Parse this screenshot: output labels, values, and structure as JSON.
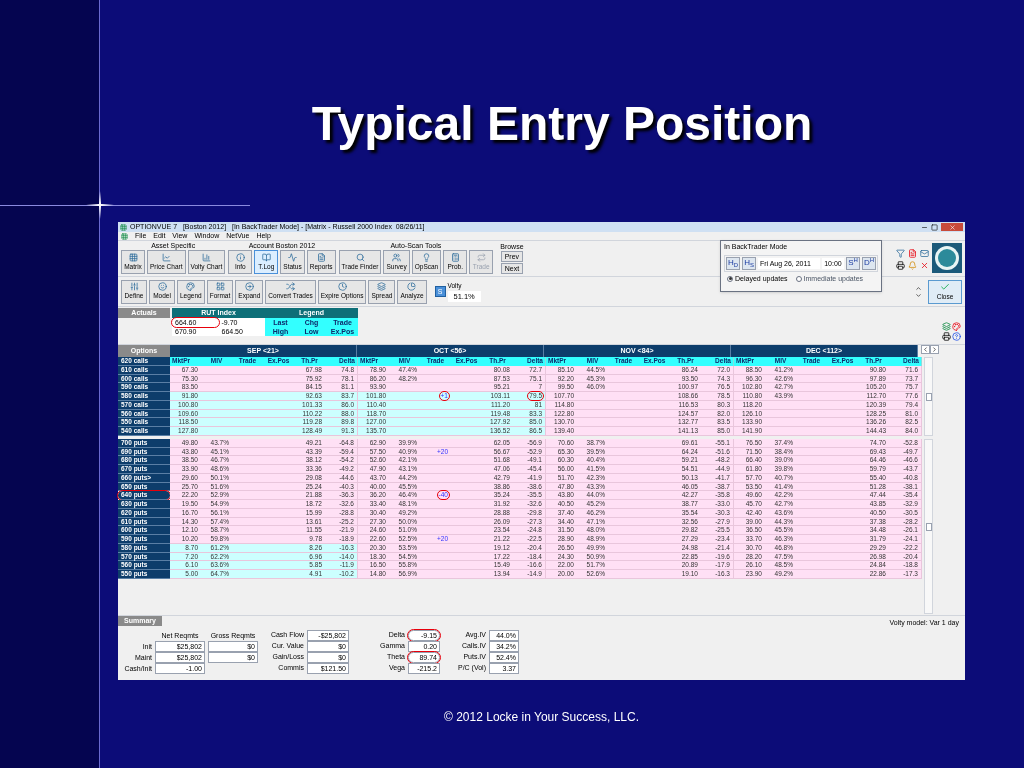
{
  "slide": {
    "title": "Typical Entry Position",
    "footer": "© 2012 Locke in Your Success, LLC."
  },
  "window": {
    "title": "OPTIONVUE 7   [Boston 2012]   [In BackTrader Mode] - [Matrix - Russell 2000 Index  08/26/11]"
  },
  "menu": [
    "File",
    "Edit",
    "View",
    "Window",
    "NetVue",
    "Help"
  ],
  "toolbar_groups": [
    {
      "label": "Asset Specific",
      "buttons": [
        {
          "label": "Matrix",
          "selected": false,
          "disabled": false
        },
        {
          "label": "Price Chart",
          "selected": false,
          "disabled": false
        },
        {
          "label": "Volty Chart",
          "selected": false,
          "disabled": false
        }
      ]
    },
    {
      "label": "Account Boston 2012",
      "buttons": [
        {
          "label": "Info",
          "selected": false,
          "disabled": false
        },
        {
          "label": "T.Log",
          "selected": true,
          "disabled": false
        },
        {
          "label": "Status",
          "selected": false,
          "disabled": false
        },
        {
          "label": "Reports",
          "selected": false,
          "disabled": false
        }
      ]
    },
    {
      "label": "Auto-Scan Tools",
      "buttons": [
        {
          "label": "Trade Finder",
          "selected": false,
          "disabled": false
        },
        {
          "label": "Survey",
          "selected": false,
          "disabled": false
        },
        {
          "label": "OpScan",
          "selected": false,
          "disabled": false
        },
        {
          "label": "Prob.",
          "selected": false,
          "disabled": false
        },
        {
          "label": "Trade",
          "selected": false,
          "disabled": true
        }
      ]
    }
  ],
  "browse": {
    "label": "Browse",
    "buttons": [
      "Prev",
      "Next"
    ]
  },
  "toolbar2": [
    "Define",
    "Model",
    "Legend",
    "Format",
    "Expand",
    "Convert Trades",
    "Expire Options",
    "Spread",
    "Analyze"
  ],
  "volty": {
    "button": "S",
    "label": "Volty",
    "value": "51.1%"
  },
  "backtrader": {
    "title": "In BackTrader Mode",
    "left_buttons": [
      "H$_{D}$",
      "H$_{S}$"
    ],
    "date": "Fri Aug 26, 2011",
    "time": "10:00",
    "right_buttons": [
      "S$^{H}$",
      "D$^{H}$"
    ],
    "options": [
      {
        "label": "Delayed updates",
        "selected": true
      },
      {
        "label": "Immediate updates",
        "selected": false
      }
    ]
  },
  "close_button": "Close",
  "actuals": {
    "label": "Actuals",
    "index_title": "RUT Index",
    "values": [
      {
        "text": "664.60",
        "circled": true
      },
      "-9.70",
      "670.90",
      "664.50"
    ],
    "legend_title": "Legend",
    "legend": [
      "Last",
      "Chg",
      "Trade",
      "High",
      "Low",
      "Ex.Pos"
    ]
  },
  "table": {
    "label": "Options",
    "months": [
      {
        "label": "SEP <21>",
        "columns": [
          "MktPr",
          "MIV",
          "Trade",
          "Ex.Pos",
          "Th.Pr",
          "Delta"
        ]
      },
      {
        "label": "OCT <56>",
        "columns": [
          "MktPr",
          "MIV",
          "Trade",
          "Ex.Pos",
          "Th.Pr",
          "Delta"
        ]
      },
      {
        "label": "NOV <84>",
        "columns": [
          "MktPr",
          "MIV",
          "Trade",
          "Ex.Pos",
          "Th.Pr",
          "Delta"
        ]
      },
      {
        "label": "DEC <112>",
        "columns": [
          "MktPr",
          "MIV",
          "Trade",
          "Ex.Pos",
          "Th.Pr",
          "Delta"
        ]
      }
    ],
    "header_row_label": "620 calls",
    "calls": [
      {
        "label": "610 calls",
        "months": [
          {
            "mkt": "67.30",
            "th": "67.98",
            "delta": "74.8",
            "itm": false
          },
          {
            "mkt": "78.90",
            "miv": "47.4%",
            "th": "80.08",
            "delta": "72.7",
            "itm": false
          },
          {
            "mkt": "85.10",
            "miv": "44.5%",
            "th": "86.24",
            "delta": "72.0",
            "itm": false
          },
          {
            "mkt": "88.50",
            "miv": "41.2%",
            "th": "90.80",
            "delta": "71.6",
            "itm": false
          }
        ]
      },
      {
        "label": "600 calls",
        "months": [
          {
            "mkt": "75.30",
            "th": "75.92",
            "delta": "78.1",
            "itm": false
          },
          {
            "mkt": "86.20",
            "miv": "48.2%",
            "th": "87.53",
            "delta": "75.1",
            "itm": false
          },
          {
            "mkt": "92.20",
            "miv": "45.3%",
            "th": "93.50",
            "delta": "74.3",
            "itm": false
          },
          {
            "mkt": "96.30",
            "miv": "42.6%",
            "th": "97.89",
            "delta": "73.7",
            "itm": false
          }
        ]
      },
      {
        "label": "590 calls",
        "months": [
          {
            "mkt": "83.50",
            "th": "84.15",
            "delta": "81.1",
            "itm": false
          },
          {
            "mkt": "93.90",
            "th": "95.21",
            "delta": "7",
            "itm": false
          },
          {
            "mkt": "99.50",
            "miv": "46.0%",
            "th": "100.97",
            "delta": "76.5",
            "itm": false
          },
          {
            "mkt": "102.80",
            "miv": "42.7%",
            "th": "105.20",
            "delta": "75.7",
            "itm": false
          }
        ]
      },
      {
        "label": "580 calls",
        "months": [
          {
            "mkt": "91.80",
            "th": "92.63",
            "delta": "83.7",
            "itm": true
          },
          {
            "mkt": "101.80",
            "trade": {
              "text": "+1",
              "circled": true
            },
            "th": "103.11",
            "delta": {
              "text": "79.5",
              "circled": true
            },
            "itm": true
          },
          {
            "mkt": "107.70",
            "th": "108.66",
            "delta": "78.5",
            "itm": false
          },
          {
            "mkt": "110.80",
            "miv": "43.9%",
            "th": "112.70",
            "delta": "77.6",
            "itm": false
          }
        ]
      },
      {
        "label": "570 calls",
        "months": [
          {
            "mkt": "100.80",
            "th": "101.33",
            "delta": "86.0",
            "itm": true
          },
          {
            "mkt": "110.40",
            "th": "111.20",
            "delta": "81",
            "itm": true
          },
          {
            "mkt": "114.80",
            "th": "116.53",
            "delta": "80.3",
            "itm": false
          },
          {
            "mkt": "118.20",
            "th": "120.39",
            "delta": "79.4",
            "itm": false
          }
        ]
      },
      {
        "label": "560 calls",
        "months": [
          {
            "mkt": "109.60",
            "th": "110.22",
            "delta": "88.0",
            "itm": true
          },
          {
            "mkt": "118.70",
            "th": "119.48",
            "delta": "83.3",
            "itm": true
          },
          {
            "mkt": "122.80",
            "th": "124.57",
            "delta": "82.0",
            "itm": false
          },
          {
            "mkt": "126.10",
            "th": "128.25",
            "delta": "81.0",
            "itm": false
          }
        ]
      },
      {
        "label": "550 calls",
        "months": [
          {
            "mkt": "118.50",
            "th": "119.28",
            "delta": "89.8",
            "itm": true
          },
          {
            "mkt": "127.00",
            "th": "127.92",
            "delta": "85.0",
            "itm": true
          },
          {
            "mkt": "130.70",
            "th": "132.77",
            "delta": "83.5",
            "itm": false
          },
          {
            "mkt": "133.90",
            "th": "136.26",
            "delta": "82.5",
            "itm": false
          }
        ]
      },
      {
        "label": "540 calls",
        "months": [
          {
            "mkt": "127.80",
            "th": "128.49",
            "delta": "91.3",
            "itm": true
          },
          {
            "mkt": "135.70",
            "th": "136.52",
            "delta": "86.5",
            "itm": true
          },
          {
            "mkt": "139.40",
            "th": "141.13",
            "delta": "85.0",
            "itm": false
          },
          {
            "mkt": "141.90",
            "th": "144.43",
            "delta": "84.0",
            "itm": false
          }
        ]
      }
    ],
    "puts": [
      {
        "label": "700 puts",
        "months": [
          {
            "mkt": "49.80",
            "miv": "43.7%",
            "th": "49.21",
            "delta": "-64.8",
            "itm": false
          },
          {
            "mkt": "62.90",
            "miv": "39.9%",
            "th": "62.05",
            "delta": "-56.9",
            "itm": false
          },
          {
            "mkt": "70.60",
            "miv": "38.7%",
            "th": "69.61",
            "delta": "-55.1",
            "itm": false
          },
          {
            "mkt": "76.50",
            "miv": "37.4%",
            "th": "74.70",
            "delta": "-52.8",
            "itm": false
          }
        ]
      },
      {
        "label": "690 puts",
        "months": [
          {
            "mkt": "43.80",
            "miv": "45.1%",
            "th": "43.39",
            "delta": "-59.4",
            "itm": false
          },
          {
            "mkt": "57.50",
            "miv": "40.9%",
            "trade": "+20",
            "th": "56.67",
            "delta": "-52.9",
            "itm": false
          },
          {
            "mkt": "65.30",
            "miv": "39.5%",
            "th": "64.24",
            "delta": "-51.6",
            "itm": false
          },
          {
            "mkt": "71.50",
            "miv": "38.4%",
            "th": "69.43",
            "delta": "-49.7",
            "itm": false
          }
        ]
      },
      {
        "label": "680 puts",
        "months": [
          {
            "mkt": "38.50",
            "miv": "46.7%",
            "th": "38.12",
            "delta": "-54.2",
            "itm": false
          },
          {
            "mkt": "52.60",
            "miv": "42.1%",
            "th": "51.68",
            "delta": "-49.1",
            "itm": false
          },
          {
            "mkt": "60.30",
            "miv": "40.4%",
            "th": "59.21",
            "delta": "-48.2",
            "itm": false
          },
          {
            "mkt": "66.40",
            "miv": "39.0%",
            "th": "64.46",
            "delta": "-46.6",
            "itm": false
          }
        ]
      },
      {
        "label": "670 puts",
        "months": [
          {
            "mkt": "33.90",
            "miv": "48.6%",
            "th": "33.36",
            "delta": "-49.2",
            "itm": false
          },
          {
            "mkt": "47.90",
            "miv": "43.1%",
            "th": "47.06",
            "delta": "-45.4",
            "itm": false
          },
          {
            "mkt": "56.00",
            "miv": "41.5%",
            "th": "54.51",
            "delta": "-44.9",
            "itm": false
          },
          {
            "mkt": "61.80",
            "miv": "39.8%",
            "th": "59.79",
            "delta": "-43.7",
            "itm": false
          }
        ]
      },
      {
        "label": "660 puts>",
        "months": [
          {
            "mkt": "29.60",
            "miv": "50.1%",
            "th": "29.08",
            "delta": "-44.6",
            "itm": false
          },
          {
            "mkt": "43.70",
            "miv": "44.2%",
            "th": "42.79",
            "delta": "-41.9",
            "itm": false
          },
          {
            "mkt": "51.70",
            "miv": "42.3%",
            "th": "50.13",
            "delta": "-41.7",
            "itm": false
          },
          {
            "mkt": "57.70",
            "miv": "40.7%",
            "th": "55.40",
            "delta": "-40.8",
            "itm": false
          }
        ]
      },
      {
        "label": "650 puts",
        "months": [
          {
            "mkt": "25.70",
            "miv": "51.6%",
            "th": "25.24",
            "delta": "-40.3",
            "itm": false
          },
          {
            "mkt": "40.00",
            "miv": "45.5%",
            "th": "38.86",
            "delta": "-38.6",
            "itm": false
          },
          {
            "mkt": "47.80",
            "miv": "43.3%",
            "th": "46.05",
            "delta": "-38.7",
            "itm": false
          },
          {
            "mkt": "53.50",
            "miv": "41.4%",
            "th": "51.28",
            "delta": "-38.1",
            "itm": false
          }
        ]
      },
      {
        "label": {
          "text": "640 puts",
          "circled": true
        },
        "months": [
          {
            "mkt": "22.20",
            "miv": "52.9%",
            "th": "21.88",
            "delta": "-36.3",
            "itm": false
          },
          {
            "mkt": "36.20",
            "miv": "46.4%",
            "trade": {
              "text": "-40",
              "circled": true
            },
            "th": "35.24",
            "delta": "-35.5",
            "itm": false
          },
          {
            "mkt": "43.80",
            "miv": "44.0%",
            "th": "42.27",
            "delta": "-35.8",
            "itm": false
          },
          {
            "mkt": "49.60",
            "miv": "42.2%",
            "th": "47.44",
            "delta": "-35.4",
            "itm": false
          }
        ]
      },
      {
        "label": "630 puts",
        "months": [
          {
            "mkt": "19.50",
            "miv": "54.9%",
            "th": "18.72",
            "delta": "-32.6",
            "itm": false
          },
          {
            "mkt": "33.40",
            "miv": "48.1%",
            "th": "31.92",
            "delta": "-32.6",
            "itm": false
          },
          {
            "mkt": "40.50",
            "miv": "45.2%",
            "th": "38.77",
            "delta": "-33.0",
            "itm": false
          },
          {
            "mkt": "45.70",
            "miv": "42.7%",
            "th": "43.85",
            "delta": "-32.9",
            "itm": false
          }
        ]
      },
      {
        "label": "620 puts",
        "months": [
          {
            "mkt": "16.70",
            "miv": "56.1%",
            "th": "15.99",
            "delta": "-28.8",
            "itm": false
          },
          {
            "mkt": "30.40",
            "miv": "49.2%",
            "th": "28.88",
            "delta": "-29.8",
            "itm": false
          },
          {
            "mkt": "37.40",
            "miv": "46.2%",
            "th": "35.54",
            "delta": "-30.3",
            "itm": false
          },
          {
            "mkt": "42.40",
            "miv": "43.6%",
            "th": "40.50",
            "delta": "-30.5",
            "itm": false
          }
        ]
      },
      {
        "label": "610 puts",
        "months": [
          {
            "mkt": "14.30",
            "miv": "57.4%",
            "th": "13.61",
            "delta": "-25.2",
            "itm": false
          },
          {
            "mkt": "27.30",
            "miv": "50.0%",
            "th": "26.09",
            "delta": "-27.3",
            "itm": false
          },
          {
            "mkt": "34.40",
            "miv": "47.1%",
            "th": "32.56",
            "delta": "-27.9",
            "itm": false
          },
          {
            "mkt": "39.00",
            "miv": "44.3%",
            "th": "37.38",
            "delta": "-28.2",
            "itm": false
          }
        ]
      },
      {
        "label": "600 puts",
        "months": [
          {
            "mkt": "12.10",
            "miv": "58.7%",
            "th": "11.55",
            "delta": "-21.9",
            "itm": false
          },
          {
            "mkt": "24.60",
            "miv": "51.0%",
            "th": "23.54",
            "delta": "-24.8",
            "itm": false
          },
          {
            "mkt": "31.50",
            "miv": "48.0%",
            "th": "29.82",
            "delta": "-25.5",
            "itm": false
          },
          {
            "mkt": "36.50",
            "miv": "45.5%",
            "th": "34.48",
            "delta": "-26.1",
            "itm": false
          }
        ]
      },
      {
        "label": "590 puts",
        "months": [
          {
            "mkt": "10.20",
            "miv": "59.8%",
            "th": "9.78",
            "delta": "-18.9",
            "itm": false
          },
          {
            "mkt": "22.60",
            "miv": "52.5%",
            "trade": "+20",
            "th": "21.22",
            "delta": "-22.5",
            "itm": false
          },
          {
            "mkt": "28.90",
            "miv": "48.9%",
            "th": "27.29",
            "delta": "-23.4",
            "itm": false
          },
          {
            "mkt": "33.70",
            "miv": "46.3%",
            "th": "31.79",
            "delta": "-24.1",
            "itm": false
          }
        ]
      },
      {
        "label": "580 puts",
        "months": [
          {
            "mkt": "8.70",
            "miv": "61.2%",
            "th": "8.26",
            "delta": "-16.3",
            "itm": true
          },
          {
            "mkt": "20.30",
            "miv": "53.5%",
            "th": "19.12",
            "delta": "-20.4",
            "itm": false
          },
          {
            "mkt": "26.50",
            "miv": "49.9%",
            "th": "24.98",
            "delta": "-21.4",
            "itm": false
          },
          {
            "mkt": "30.70",
            "miv": "46.8%",
            "th": "29.29",
            "delta": "-22.2",
            "itm": false
          }
        ]
      },
      {
        "label": "570 puts",
        "months": [
          {
            "mkt": "7.20",
            "miv": "62.2%",
            "th": "6.96",
            "delta": "-14.0",
            "itm": true
          },
          {
            "mkt": "18.30",
            "miv": "54.5%",
            "th": "17.22",
            "delta": "-18.4",
            "itm": false
          },
          {
            "mkt": "24.30",
            "miv": "50.9%",
            "th": "22.85",
            "delta": "-19.6",
            "itm": false
          },
          {
            "mkt": "28.20",
            "miv": "47.5%",
            "th": "26.98",
            "delta": "-20.4",
            "itm": false
          }
        ]
      },
      {
        "label": "560 puts",
        "months": [
          {
            "mkt": "6.10",
            "miv": "63.6%",
            "th": "5.85",
            "delta": "-11.9",
            "itm": true
          },
          {
            "mkt": "16.50",
            "miv": "55.8%",
            "th": "15.49",
            "delta": "-16.6",
            "itm": false
          },
          {
            "mkt": "22.00",
            "miv": "51.7%",
            "th": "20.89",
            "delta": "-17.9",
            "itm": false
          },
          {
            "mkt": "26.10",
            "miv": "48.5%",
            "th": "24.84",
            "delta": "-18.8",
            "itm": false
          }
        ]
      },
      {
        "label": "550 puts",
        "months": [
          {
            "mkt": "5.00",
            "miv": "64.7%",
            "th": "4.91",
            "delta": "-10.2",
            "itm": true
          },
          {
            "mkt": "14.80",
            "miv": "56.9%",
            "th": "13.94",
            "delta": "-14.9",
            "itm": false
          },
          {
            "mkt": "20.00",
            "miv": "52.6%",
            "th": "19.10",
            "delta": "-16.3",
            "itm": false
          },
          {
            "mkt": "23.90",
            "miv": "49.2%",
            "th": "22.86",
            "delta": "-17.3",
            "itm": false
          }
        ]
      }
    ]
  },
  "summary": {
    "label": "Summary",
    "volty_model": "Volty model: Var 1 day",
    "req_headers": [
      "Net Reqmts",
      "Gross Reqmts"
    ],
    "reqs": [
      {
        "label": "Init",
        "net": "$25,802",
        "gross": "$0"
      },
      {
        "label": "Maint",
        "net": "$25,802",
        "gross": "$0"
      },
      {
        "label": "Cash/Init",
        "net": "-1.00"
      }
    ],
    "cash": [
      {
        "label": "Cash Flow",
        "value": "-$25,802"
      },
      {
        "label": "Cur. Value",
        "value": "$0"
      },
      {
        "label": "Gain/Loss",
        "value": "$0"
      },
      {
        "label": "Commis",
        "value": "$121.50"
      }
    ],
    "greeks": [
      {
        "label": "Delta",
        "value": {
          "text": "-9.15",
          "circled": true
        }
      },
      {
        "label": "Gamma",
        "value": "0.20"
      },
      {
        "label": "Theta",
        "value": {
          "text": "89.74",
          "circled": true
        }
      },
      {
        "label": "Vega",
        "value": "-215.2"
      }
    ],
    "iv": [
      {
        "label": "Avg.IV",
        "value": "44.0%"
      },
      {
        "label": "Calls.IV",
        "value": "34.2%"
      },
      {
        "label": "Puts.IV",
        "value": "52.4%"
      },
      {
        "label": "P/C (Vol)",
        "value": "3.37"
      }
    ]
  }
}
